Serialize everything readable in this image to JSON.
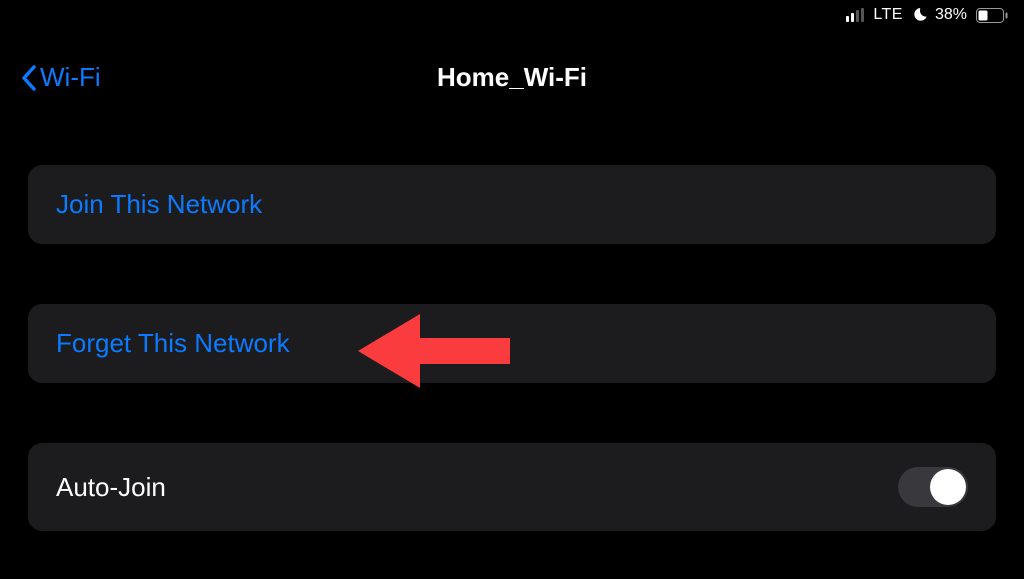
{
  "status_bar": {
    "network_label": "LTE",
    "battery_percent": "38%"
  },
  "nav": {
    "back_label": "Wi-Fi",
    "title": "Home_Wi-Fi"
  },
  "cells": {
    "join": {
      "label": "Join This Network"
    },
    "forget": {
      "label": "Forget This Network"
    },
    "auto_join": {
      "label": "Auto-Join",
      "toggle_on": false
    }
  },
  "colors": {
    "accent": "#0a7aff",
    "annotation": "#fa3c3e"
  }
}
